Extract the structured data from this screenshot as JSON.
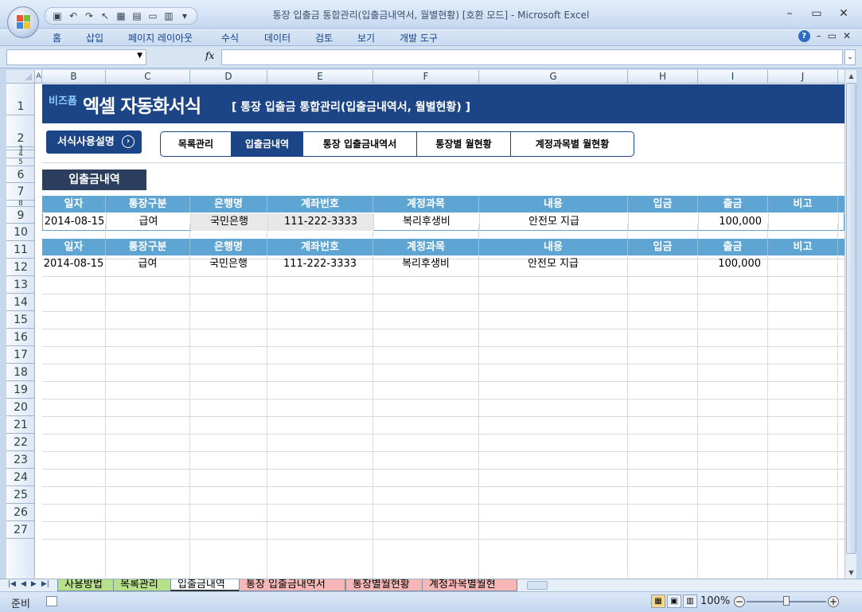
{
  "window": {
    "title": "통장 입출금 통합관리(입출금내역서, 월별현황)  [호환 모드] - Microsoft Excel",
    "controls": [
      "–",
      "▭",
      "✕"
    ]
  },
  "qat": {
    "icons": [
      "save-icon",
      "undo-icon",
      "redo-icon",
      "select-icon",
      "grid-icon",
      "table-icon",
      "form-icon",
      "freeze-icon",
      "customize-icon"
    ]
  },
  "ribbon": {
    "tabs": [
      "홈",
      "삽입",
      "페이지 레이아웃",
      "수식",
      "데이터",
      "검토",
      "보기",
      "개발 도구"
    ],
    "help": "?"
  },
  "formula_bar": {
    "namebox": "",
    "fx": "fx",
    "content": ""
  },
  "columns": [
    "A",
    "B",
    "C",
    "D",
    "E",
    "F",
    "G",
    "H",
    "I",
    "J"
  ],
  "rows": [
    "1",
    "2",
    "3",
    "4",
    "5",
    "6",
    "7",
    "8",
    "9",
    "10",
    "11",
    "12",
    "13",
    "14",
    "15",
    "16",
    "17",
    "18",
    "19",
    "20",
    "21",
    "22",
    "23",
    "24",
    "25",
    "26",
    "27"
  ],
  "banner": {
    "logo": "비즈폼",
    "title": "엑셀 자동화서식",
    "subtitle": "[ 통장 입출금 통합관리(입출금내역서, 월별현황) ]"
  },
  "guide_button": {
    "label": "서식사용설명",
    "arrow": "›"
  },
  "nav_tabs": [
    "목록관리",
    "입출금내역",
    "통장 입출금내역서",
    "통장별 월현황",
    "계정과목별 월현황"
  ],
  "nav_active": "입출금내역",
  "section_label": "입출금내역",
  "table_headers": [
    "일자",
    "통장구분",
    "은행명",
    "계좌번호",
    "계정과목",
    "내용",
    "입금",
    "출금",
    "비고"
  ],
  "filter_row": [
    "2014-08-15",
    "급여",
    "국민은행",
    "111-222-3333",
    "복리후생비",
    "안전모 지급",
    "",
    "100,000",
    ""
  ],
  "data_rows": [
    [
      "2014-08-15",
      "급여",
      "국민은행",
      "111-222-3333",
      "복리후생비",
      "안전모 지급",
      "",
      "100,000",
      ""
    ]
  ],
  "sheet_tabs": [
    "사용방법",
    "목록관리",
    "입출금내역",
    "통장 입출금내역서",
    "통장별월현황",
    "계정과목별월현"
  ],
  "sheet_tab_colors": [
    "#b7e08a",
    "#b7e08a",
    "#ffffff",
    "#f7b7b7",
    "#f7b7b7",
    "#f7b7b7"
  ],
  "active_sheet": "입출금내역",
  "status": {
    "ready": "준비",
    "zoom": "100%",
    "zoom_minus": "−",
    "zoom_plus": "+"
  },
  "colors": {
    "banner": "#1c4587",
    "header": "#5ea5d4",
    "section": "#2c3e5e"
  }
}
